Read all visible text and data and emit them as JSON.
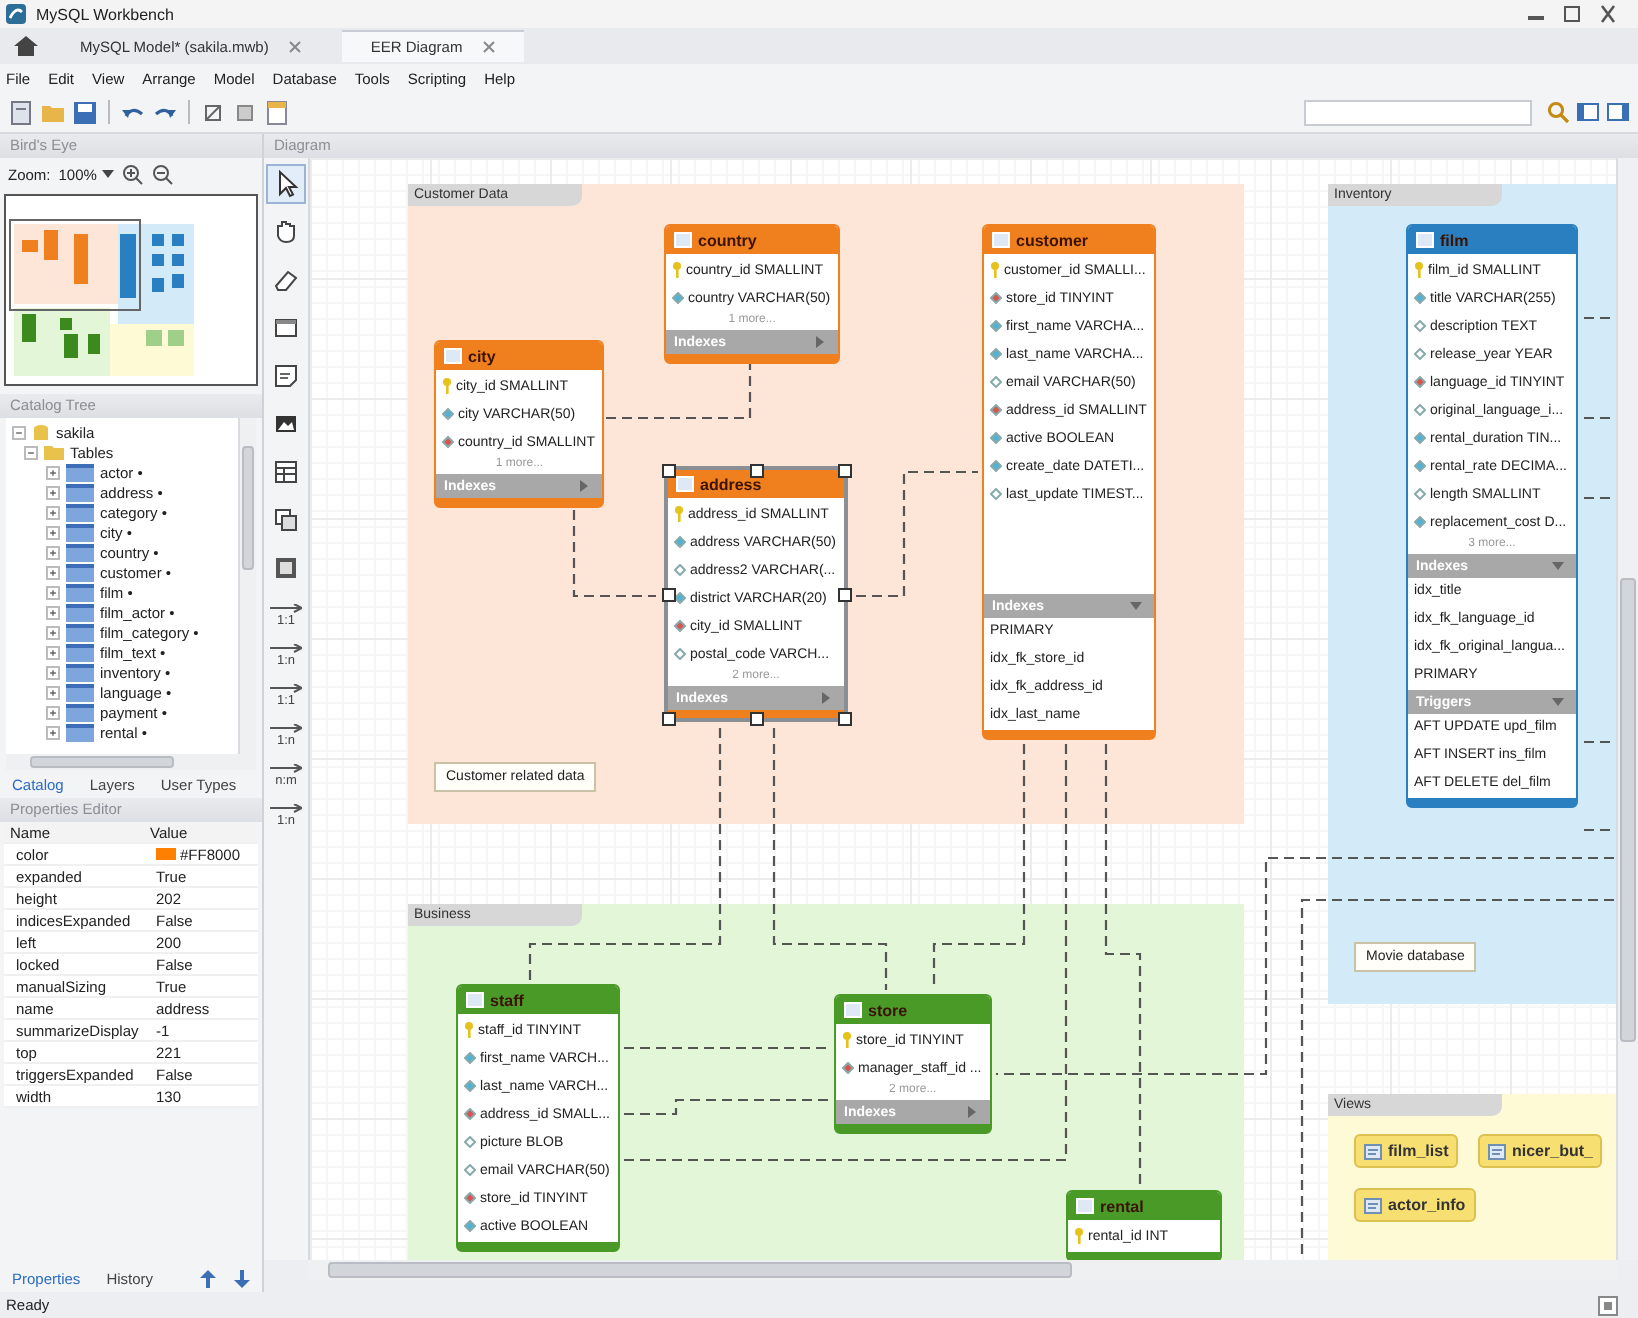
{
  "window": {
    "title": "MySQL Workbench"
  },
  "tabs": [
    {
      "label": "MySQL Model* (sakila.mwb)",
      "selected": false
    },
    {
      "label": "EER Diagram",
      "selected": true
    }
  ],
  "menu": [
    "File",
    "Edit",
    "View",
    "Arrange",
    "Model",
    "Database",
    "Tools",
    "Scripting",
    "Help"
  ],
  "birds_eye": {
    "title": "Bird's Eye",
    "zoom_label": "Zoom:",
    "zoom": "100%"
  },
  "catalog_tree": {
    "title": "Catalog Tree",
    "items": [
      {
        "label": "sakila",
        "expanded": true,
        "children": [
          {
            "label": "Tables",
            "expanded": true,
            "children": [
              {
                "label": "actor •",
                "expanded": false
              },
              {
                "label": "address •",
                "expanded": false
              },
              {
                "label": "category •",
                "expanded": false
              },
              {
                "label": "city •",
                "expanded": false
              },
              {
                "label": "country •",
                "expanded": false
              },
              {
                "label": "customer •",
                "expanded": false
              },
              {
                "label": "film •",
                "expanded": false
              },
              {
                "label": "film_actor •",
                "expanded": false
              },
              {
                "label": "film_category •",
                "expanded": false
              },
              {
                "label": "film_text •",
                "expanded": false
              },
              {
                "label": "inventory •",
                "expanded": false
              },
              {
                "label": "language •",
                "expanded": false
              },
              {
                "label": "payment •",
                "expanded": false
              },
              {
                "label": "rental •",
                "expanded": false
              }
            ]
          }
        ]
      }
    ]
  },
  "catalog_tabs": [
    {
      "label": "Catalog",
      "selected": true
    },
    {
      "label": "Layers",
      "selected": false
    },
    {
      "label": "User Types",
      "selected": false
    }
  ],
  "properties": {
    "title": "Properties Editor",
    "columns": [
      "Name",
      "Value"
    ],
    "rows": [
      {
        "name": "color",
        "value": "#FF8000",
        "color": "#ff8000"
      },
      {
        "name": "expanded",
        "value": "True"
      },
      {
        "name": "height",
        "value": "202"
      },
      {
        "name": "indicesExpanded",
        "value": "False"
      },
      {
        "name": "left",
        "value": "200"
      },
      {
        "name": "locked",
        "value": "False"
      },
      {
        "name": "manualSizing",
        "value": "True"
      },
      {
        "name": "name",
        "value": "address"
      },
      {
        "name": "summarizeDisplay",
        "value": "-1"
      },
      {
        "name": "top",
        "value": "221"
      },
      {
        "name": "triggersExpanded",
        "value": "False"
      },
      {
        "name": "width",
        "value": "130"
      }
    ]
  },
  "bottom_tabs": [
    {
      "label": "Properties",
      "selected": true
    },
    {
      "label": "History",
      "selected": false
    }
  ],
  "diagram": {
    "title": "Diagram",
    "tools": [
      "1:1",
      "1:n",
      "1:1",
      "1:n",
      "n:m",
      "1:n"
    ],
    "layers": [
      {
        "name": "Customer Data",
        "color": "#fde5d8"
      },
      {
        "name": "Inventory",
        "color": "#d3ebf8"
      },
      {
        "name": "Business",
        "color": "#e3f6d8"
      },
      {
        "name": "Views",
        "color": "#fffad6"
      }
    ],
    "tables": [
      {
        "name": "country",
        "color": "#f0801e",
        "selected": false,
        "columns": [
          {
            "kind": "pk",
            "text": "country_id SMALLINT"
          },
          {
            "kind": "nn",
            "text": "country VARCHAR(50)"
          }
        ],
        "more": "1 more...",
        "sections": [
          {
            "label": "Indexes",
            "expanded": false
          }
        ]
      },
      {
        "name": "city",
        "color": "#f0801e",
        "selected": false,
        "columns": [
          {
            "kind": "pk",
            "text": "city_id SMALLINT"
          },
          {
            "kind": "nn",
            "text": "city VARCHAR(50)"
          },
          {
            "kind": "fk",
            "text": "country_id SMALLINT"
          }
        ],
        "more": "1 more...",
        "sections": [
          {
            "label": "Indexes",
            "expanded": false
          }
        ]
      },
      {
        "name": "address",
        "color": "#f0801e",
        "selected": true,
        "columns": [
          {
            "kind": "pk",
            "text": "address_id SMALLINT"
          },
          {
            "kind": "nn",
            "text": "address VARCHAR(50)"
          },
          {
            "kind": "null",
            "text": "address2 VARCHAR(..."
          },
          {
            "kind": "nn",
            "text": "district VARCHAR(20)"
          },
          {
            "kind": "fk",
            "text": "city_id SMALLINT"
          },
          {
            "kind": "null",
            "text": "postal_code VARCH..."
          }
        ],
        "more": "2 more...",
        "sections": [
          {
            "label": "Indexes",
            "expanded": false
          }
        ]
      },
      {
        "name": "customer",
        "color": "#f0801e",
        "selected": false,
        "columns": [
          {
            "kind": "pk",
            "text": "customer_id SMALLI..."
          },
          {
            "kind": "fk",
            "text": "store_id TINYINT"
          },
          {
            "kind": "nn",
            "text": "first_name VARCHA..."
          },
          {
            "kind": "nn",
            "text": "last_name VARCHA..."
          },
          {
            "kind": "null",
            "text": "email VARCHAR(50)"
          },
          {
            "kind": "fk",
            "text": "address_id SMALLINT"
          },
          {
            "kind": "nn",
            "text": "active BOOLEAN"
          },
          {
            "kind": "nn",
            "text": "create_date DATETI..."
          },
          {
            "kind": "null",
            "text": "last_update TIMEST..."
          }
        ],
        "sections": [
          {
            "label": "Indexes",
            "expanded": true,
            "items": [
              "PRIMARY",
              "idx_fk_store_id",
              "idx_fk_address_id",
              "idx_last_name"
            ]
          }
        ]
      },
      {
        "name": "film",
        "color": "#2a7fc0",
        "selected": false,
        "columns": [
          {
            "kind": "pk",
            "text": "film_id SMALLINT"
          },
          {
            "kind": "nn",
            "text": "title VARCHAR(255)"
          },
          {
            "kind": "null",
            "text": "description TEXT"
          },
          {
            "kind": "null",
            "text": "release_year YEAR"
          },
          {
            "kind": "fk",
            "text": "language_id TINYINT"
          },
          {
            "kind": "null",
            "text": "original_language_i..."
          },
          {
            "kind": "nn",
            "text": "rental_duration TIN..."
          },
          {
            "kind": "nn",
            "text": "rental_rate DECIMA..."
          },
          {
            "kind": "null",
            "text": "length SMALLINT"
          },
          {
            "kind": "nn",
            "text": "replacement_cost D..."
          }
        ],
        "more": "3 more...",
        "sections": [
          {
            "label": "Indexes",
            "expanded": true,
            "items": [
              "idx_title",
              "idx_fk_language_id",
              "idx_fk_original_langua...",
              "PRIMARY"
            ]
          },
          {
            "label": "Triggers",
            "expanded": true,
            "items": [
              "AFT UPDATE upd_film",
              "AFT INSERT ins_film",
              "AFT DELETE del_film"
            ]
          }
        ]
      },
      {
        "name": "staff",
        "color": "#4a9a28",
        "selected": false,
        "columns": [
          {
            "kind": "pk",
            "text": "staff_id TINYINT"
          },
          {
            "kind": "nn",
            "text": "first_name VARCH..."
          },
          {
            "kind": "nn",
            "text": "last_name VARCH..."
          },
          {
            "kind": "fk",
            "text": "address_id SMALL..."
          },
          {
            "kind": "null",
            "text": "picture BLOB"
          },
          {
            "kind": "null",
            "text": "email VARCHAR(50)"
          },
          {
            "kind": "fk",
            "text": "store_id TINYINT"
          },
          {
            "kind": "nn",
            "text": "active BOOLEAN"
          }
        ]
      },
      {
        "name": "store",
        "color": "#4a9a28",
        "selected": false,
        "columns": [
          {
            "kind": "pk",
            "text": "store_id TINYINT"
          },
          {
            "kind": "fk",
            "text": "manager_staff_id ..."
          }
        ],
        "more": "2 more...",
        "sections": [
          {
            "label": "Indexes",
            "expanded": false
          }
        ]
      },
      {
        "name": "rental",
        "color": "#4a9a28",
        "selected": false,
        "columns": [
          {
            "kind": "pk",
            "text": "rental_id INT"
          }
        ]
      }
    ],
    "notes": [
      "Customer related data",
      "Movie database"
    ],
    "views": [
      "film_list",
      "nicer_but_",
      "actor_info"
    ]
  },
  "status_bar": "Ready"
}
